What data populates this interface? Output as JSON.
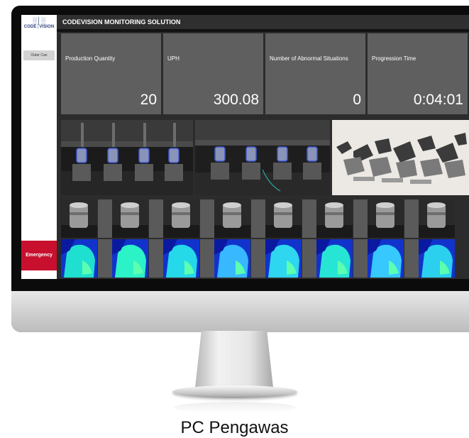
{
  "app": {
    "title": "CODEVISION MONITORING SOLUTION",
    "logo_text": "CODE│VISION"
  },
  "sidebar": {
    "items": [
      {
        "label": "Outer Can"
      }
    ],
    "emergency_label": "Emergency"
  },
  "stats": [
    {
      "label": "Production Quantity",
      "value": "20"
    },
    {
      "label": "UPH",
      "value": "300.08"
    },
    {
      "label": "Number of Abnormal Situations",
      "value": "0"
    },
    {
      "label": "Progression Time",
      "value": "0:04:01"
    }
  ],
  "camera_feeds": [
    {
      "name": "camera-1"
    },
    {
      "name": "camera-2"
    },
    {
      "name": "parts-view"
    }
  ],
  "tile_rows": {
    "rgb_count": 8,
    "depth_count": 8
  },
  "caption": "PC Pengawas",
  "colors": {
    "emergency": "#c8102e",
    "stat_panel": "#5f5f5f",
    "title_bar": "#2f2f2f"
  }
}
